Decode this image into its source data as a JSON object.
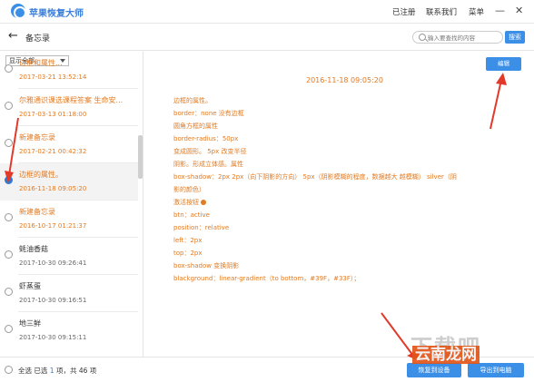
{
  "app": {
    "title": "苹果恢复大师"
  },
  "header": {
    "links": [
      "已注册",
      "联系我们",
      "菜单"
    ],
    "min": "—",
    "close": "✕"
  },
  "nav": {
    "back": "←",
    "title": "备忘录",
    "search_placeholder": "输入要查找的内容",
    "search_button": "搜索"
  },
  "list": {
    "filter": "显示全部",
    "items": [
      {
        "title": "边框和属性...",
        "date": "2017-03-21 13:52:14",
        "color": "orange"
      },
      {
        "title": "尔雅通识课选课程答案 生命安...",
        "date": "2017-03-13 01:18:00",
        "color": "orange"
      },
      {
        "title": "新建备忘录",
        "date": "2017-02-21 00:42:32",
        "color": "orange"
      },
      {
        "title": "边框的属性。",
        "date": "2016-11-18 09:05:20",
        "color": "orange"
      },
      {
        "title": "新建备忘录",
        "date": "2016-10-17 01:21:37",
        "color": "orange"
      },
      {
        "title": "蚝油香菇",
        "date": "2017-10-30 09:26:41",
        "color": "gray"
      },
      {
        "title": "虾蒸蛋",
        "date": "2017-10-30 09:16:51",
        "color": "gray"
      },
      {
        "title": "地三鲜",
        "date": "2017-10-30 09:15:11",
        "color": "gray"
      }
    ]
  },
  "note": {
    "edit_button": "编辑",
    "date": "2016-11-18 09:05:20",
    "lines": [
      "边框的属性。",
      "border：none   没有边框",
      "圆角方框的属性",
      "border-radius：50px",
      "变成圆形。        5px   改变半径",
      "阴影。形成立体感。属性",
      "box-shadow：2px     2px（向下阴影的方向）    5px（阴影模糊的程度，数据越大 越模糊） silver（阴",
      "影的颜色）",
      "激活按钮",
      "btn：active",
      "position：relative",
      "left：2px",
      "top：2px",
      "box-shadow 变换阴影",
      "blackground：linear-gradient（to bottom，#39F，#33F）；"
    ]
  },
  "footer": {
    "select_all": "全选",
    "selected_prefix": "已选",
    "selected_count": "1",
    "selected_mid": "项，共",
    "total": "46",
    "total_suffix": "项",
    "restore_button": "恢复到设备",
    "export_button": "导出到电脑"
  },
  "watermark": {
    "big": "下载吧",
    "small": "云南龙网"
  },
  "colors": {
    "accent": "#3b8fe6",
    "note_text": "#e27a21",
    "arrow": "#e23a2a"
  }
}
